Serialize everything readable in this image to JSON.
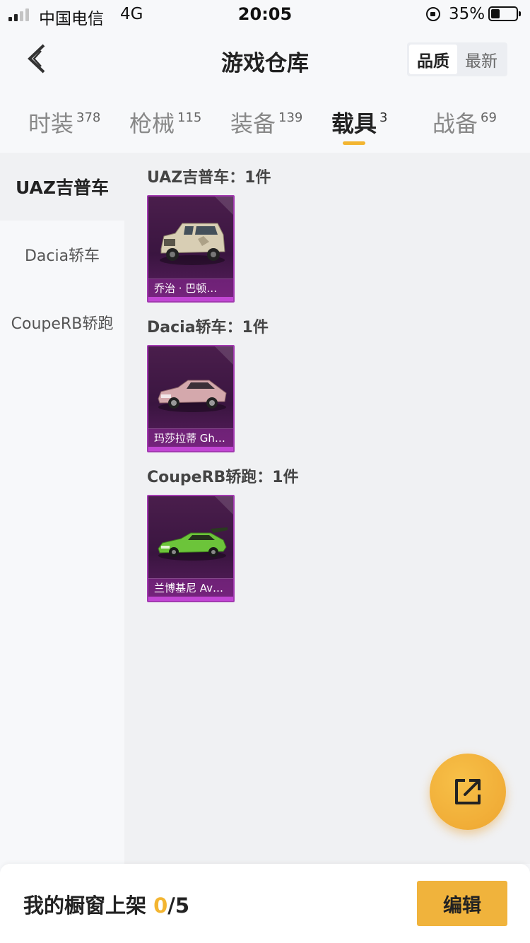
{
  "status_bar": {
    "carrier": "中国电信",
    "network": "4G",
    "time": "20:05",
    "battery_percent": "35%"
  },
  "header": {
    "title": "游戏仓库",
    "sort_options": [
      "品质",
      "最新"
    ],
    "sort_selected": "品质"
  },
  "tabs": [
    {
      "label": "时装",
      "count": "378"
    },
    {
      "label": "枪械",
      "count": "115"
    },
    {
      "label": "装备",
      "count": "139"
    },
    {
      "label": "载具",
      "count": "3"
    },
    {
      "label": "战备",
      "count": "69"
    }
  ],
  "active_tab": "载具",
  "sidebar": {
    "items": [
      "UAZ吉普车",
      "Dacia轿车",
      "CoupeRB轿跑"
    ],
    "selected": "UAZ吉普车"
  },
  "groups": [
    {
      "title": "UAZ吉普车：1件",
      "items": [
        {
          "name": "乔治 · 巴顿…",
          "icon": "jeep-icon"
        }
      ]
    },
    {
      "title": "Dacia轿车：1件",
      "items": [
        {
          "name": "玛莎拉蒂 Gh…",
          "icon": "sedan-icon"
        }
      ]
    },
    {
      "title": "CoupeRB轿跑：1件",
      "items": [
        {
          "name": "兰博基尼 Av…",
          "icon": "sports-car-icon"
        }
      ]
    }
  ],
  "bottom_bar": {
    "shelf_label": "我的橱窗上架 ",
    "shelf_used": "0",
    "shelf_total": "/5",
    "edit_label": "编辑"
  },
  "colors": {
    "accent": "#f3b531",
    "card_border": "#a23ab0",
    "card_bg": "#3a1540"
  }
}
